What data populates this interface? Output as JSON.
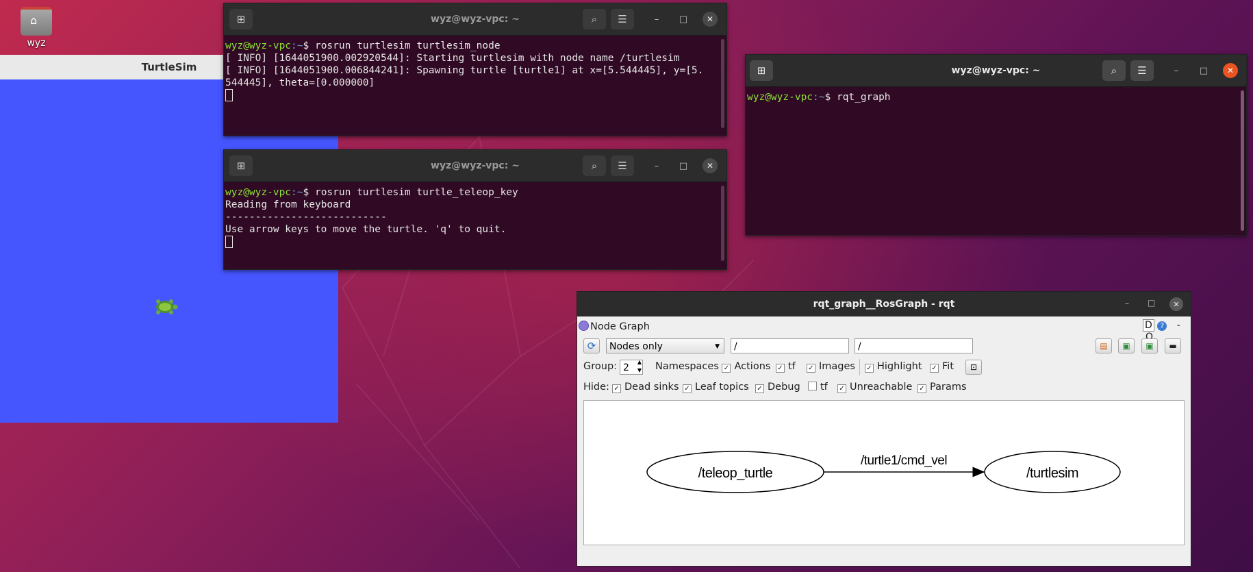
{
  "desktop": {
    "home_label": "wyz"
  },
  "turtlesim": {
    "title": "TurtleSim"
  },
  "terminal1": {
    "title": "wyz@wyz-vpc: ~",
    "prompt_user": "wyz@wyz-vpc",
    "prompt_path": ":~",
    "command": "$ rosrun turtlesim turtlesim_node",
    "lines": [
      "[ INFO] [1644051900.002920544]: Starting turtlesim with node name /turtlesim",
      "[ INFO] [1644051900.006844241]: Spawning turtle [turtle1] at x=[5.544445], y=[5.",
      "544445], theta=[0.000000]"
    ]
  },
  "terminal2": {
    "title": "wyz@wyz-vpc: ~",
    "prompt_user": "wyz@wyz-vpc",
    "prompt_path": ":~",
    "command": "$ rosrun turtlesim turtle_teleop_key",
    "lines": [
      "Reading from keyboard",
      "---------------------------",
      "Use arrow keys to move the turtle. 'q' to quit."
    ]
  },
  "terminal3": {
    "title": "wyz@wyz-vpc: ~",
    "prompt_user": "wyz@wyz-vpc",
    "prompt_path": ":~",
    "command": "$ rqt_graph"
  },
  "rqt": {
    "title": "rqt_graph__RosGraph - rqt",
    "plugin_title": "Node Graph",
    "plugin_controls": "D",
    "plugin_help": "?",
    "plugin_min": "-",
    "plugin_close": "O",
    "mode_select": "Nodes only",
    "filter1": "/",
    "filter2": "/",
    "group_label": "Group:",
    "group_value": "2",
    "group_options": [
      {
        "label": "Namespaces",
        "checked": false
      },
      {
        "label": "Actions",
        "checked": true
      },
      {
        "label": "tf",
        "checked": true
      },
      {
        "label": "Images",
        "checked": true
      },
      {
        "label": "Highlight",
        "checked": true
      },
      {
        "label": "Fit",
        "checked": true
      }
    ],
    "hide_label": "Hide:",
    "hide_options": [
      {
        "label": "Dead sinks",
        "checked": true
      },
      {
        "label": "Leaf topics",
        "checked": true
      },
      {
        "label": "Debug",
        "checked": true
      },
      {
        "label": "tf",
        "checked": false
      },
      {
        "label": "Unreachable",
        "checked": true
      },
      {
        "label": "Params",
        "checked": true
      }
    ],
    "graph": {
      "nodes": [
        "/teleop_turtle",
        "/turtlesim"
      ],
      "edge_label": "/turtle1/cmd_vel"
    }
  },
  "icons": {
    "new_tab": "new-tab-icon",
    "search": "search-icon",
    "menu": "hamburger-menu-icon",
    "minimize": "minimize-icon",
    "maximize": "maximize-icon",
    "close": "close-icon",
    "refresh": "refresh-icon"
  },
  "colors": {
    "terminal_bg": "#300a24",
    "prompt_user": "#8ae234",
    "prompt_path": "#729fcf",
    "turtlesim_bg": "#4556ff",
    "close_active": "#e95420"
  }
}
